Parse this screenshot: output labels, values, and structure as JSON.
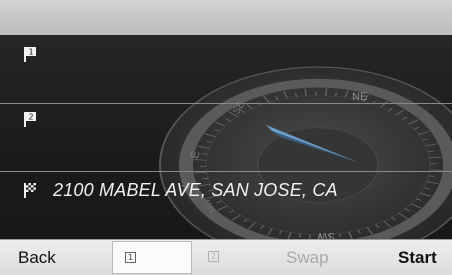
{
  "destinations": [
    {
      "label": "",
      "icon": "flag-1-icon"
    },
    {
      "label": "",
      "icon": "flag-2-icon"
    },
    {
      "label": "2100 MABEL AVE, SAN JOSE, CA",
      "icon": "checkered-flag-icon"
    }
  ],
  "flag_numbers": [
    "1",
    "2"
  ],
  "compass": {
    "ne": "NE",
    "se": "SE",
    "e": "E",
    "w": "W",
    "sw": "SW",
    "nw": "NW"
  },
  "softkeys": {
    "back": "Back",
    "dest1_number": "1",
    "dest2_number": "2",
    "swap": "Swap",
    "start": "Start"
  },
  "colors": {
    "panel": "#1b1b1b",
    "text": "#f2f2f2",
    "needle": "#6d9fcc",
    "disabled": "#a8a8a8"
  }
}
